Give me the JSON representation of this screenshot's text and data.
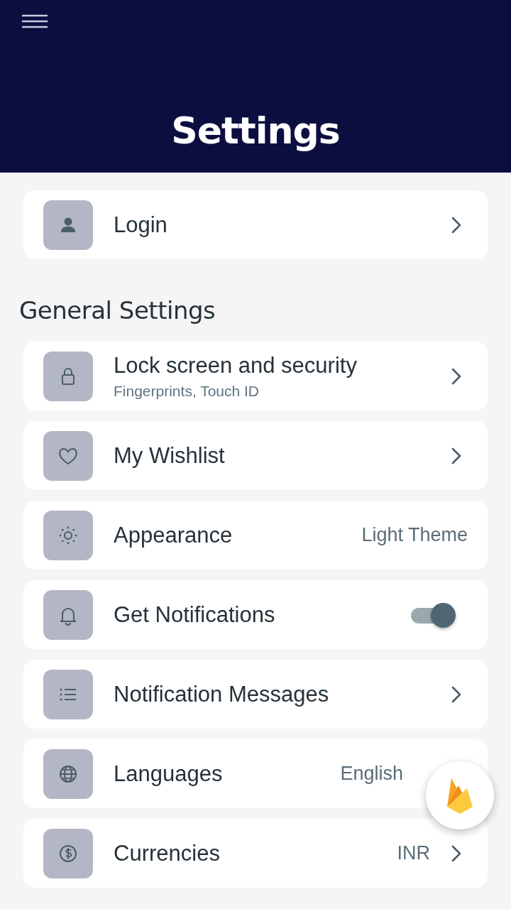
{
  "header": {
    "title": "Settings"
  },
  "login": {
    "label": "Login"
  },
  "section": {
    "title": "General Settings"
  },
  "rows": [
    {
      "kind": "chevron",
      "label": "Lock screen and security",
      "subtitle": "Fingerprints, Touch ID"
    },
    {
      "kind": "chevron",
      "label": "My Wishlist"
    },
    {
      "kind": "value",
      "label": "Appearance",
      "value": "Light Theme"
    },
    {
      "kind": "toggle",
      "label": "Get Notifications",
      "on": true
    },
    {
      "kind": "chevron",
      "label": "Notification Messages"
    },
    {
      "kind": "value_beside_button",
      "label": "Languages",
      "value": "English"
    },
    {
      "kind": "value_chevron",
      "label": "Currencies",
      "value": "INR"
    }
  ]
}
